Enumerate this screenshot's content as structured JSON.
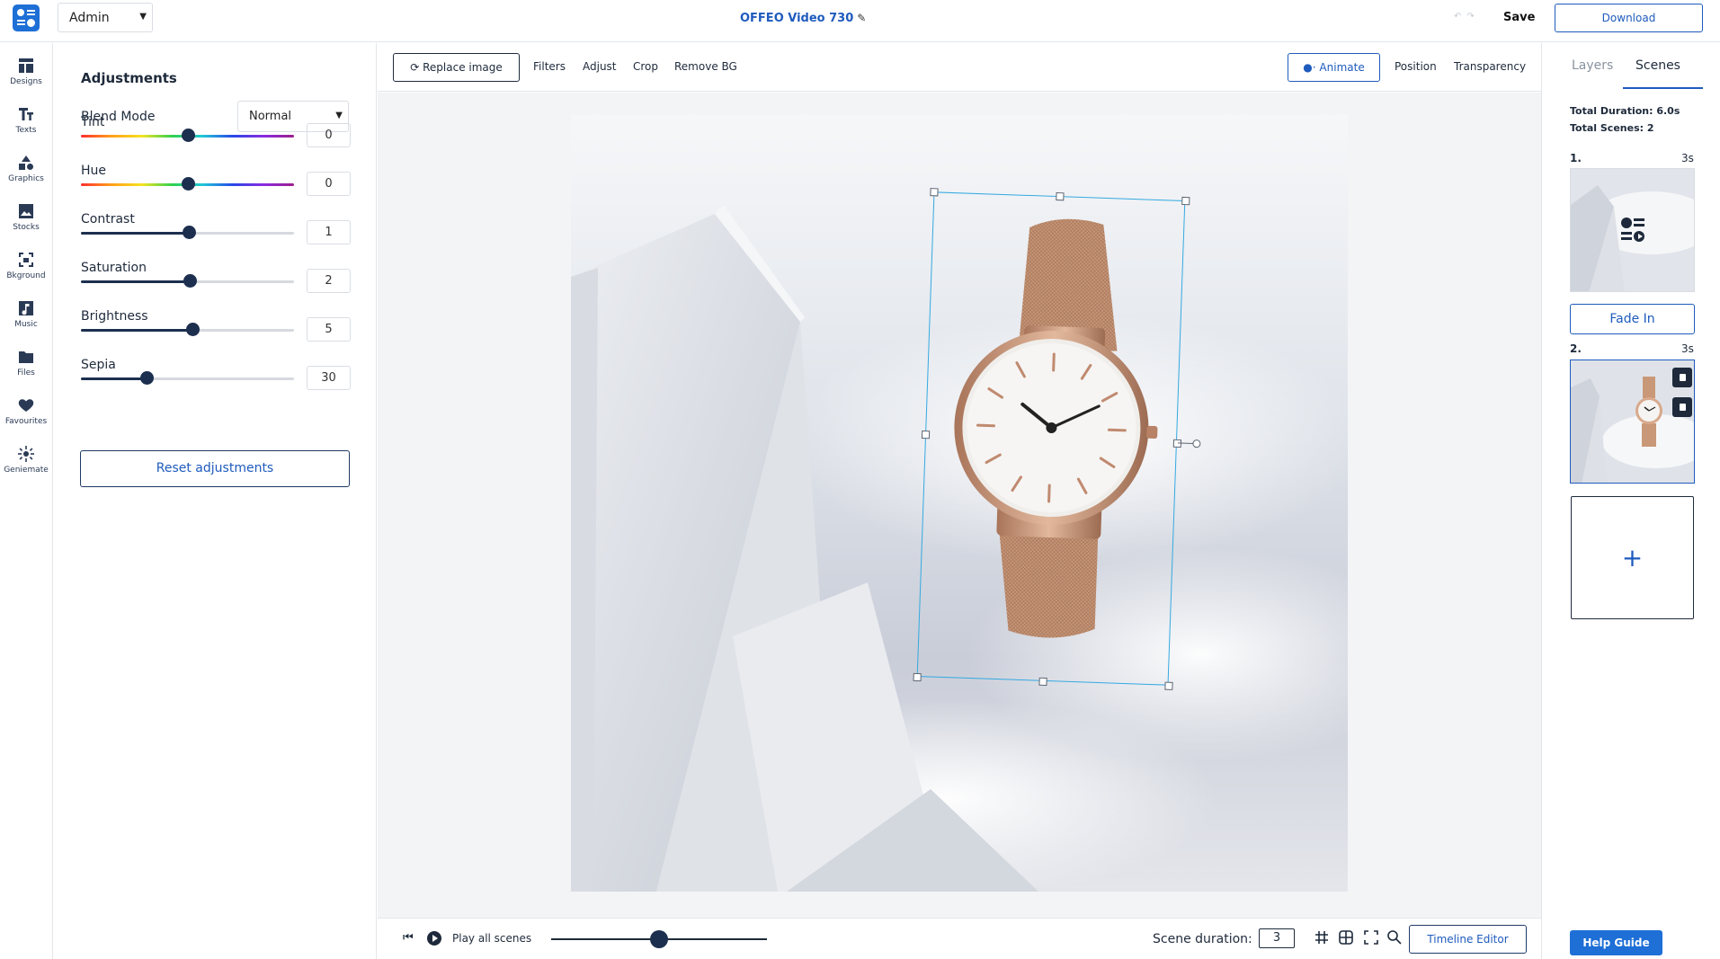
{
  "header": {
    "account": "Admin",
    "title": "OFFEO Video 730",
    "save_label": "Save",
    "download_label": "Download"
  },
  "rail": {
    "items": [
      {
        "label": "Designs",
        "icon": "designs-icon"
      },
      {
        "label": "Texts",
        "icon": "texts-icon"
      },
      {
        "label": "Graphics",
        "icon": "graphics-icon"
      },
      {
        "label": "Stocks",
        "icon": "stocks-icon"
      },
      {
        "label": "Bkground",
        "icon": "background-icon"
      },
      {
        "label": "Music",
        "icon": "music-icon"
      },
      {
        "label": "Files",
        "icon": "files-icon"
      },
      {
        "label": "Favourites",
        "icon": "heart-icon"
      },
      {
        "label": "Geniemate",
        "icon": "geniemate-icon"
      }
    ]
  },
  "adjustments": {
    "title": "Adjustments",
    "blend_mode_label": "Blend Mode",
    "blend_mode_value": "Normal",
    "sliders": [
      {
        "label": "Tint",
        "value": "0",
        "level": 0.5,
        "style": "rainbow"
      },
      {
        "label": "Hue",
        "value": "0",
        "level": 0.5,
        "style": "rainbow"
      },
      {
        "label": "Contrast",
        "value": "1",
        "level": 0.505,
        "style": "plain"
      },
      {
        "label": "Saturation",
        "value": "2",
        "level": 0.51,
        "style": "plain"
      },
      {
        "label": "Brightness",
        "value": "5",
        "level": 0.525,
        "style": "plain"
      },
      {
        "label": "Sepia",
        "value": "30",
        "level": 0.31,
        "style": "plain"
      }
    ],
    "reset_label": "Reset adjustments"
  },
  "toolbar": {
    "replace_label": "Replace image",
    "filters_label": "Filters",
    "adjust_label": "Adjust",
    "crop_label": "Crop",
    "remove_bg_label": "Remove BG",
    "animate_label": "Animate",
    "position_label": "Position",
    "transparency_label": "Transparency"
  },
  "bottom": {
    "play_all_label": "Play all scenes",
    "timeline_progress": 0.5,
    "scene_duration_label": "Scene duration:",
    "scene_duration_value": "3",
    "timeline_editor_label": "Timeline Editor"
  },
  "scenes_panel": {
    "tab_layers": "Layers",
    "tab_scenes": "Scenes",
    "total_duration": "Total Duration: 6.0s",
    "total_scenes": "Total Scenes: 2",
    "scenes": [
      {
        "number": "1.",
        "duration": "3s",
        "transition": "Fade In"
      },
      {
        "number": "2.",
        "duration": "3s"
      }
    ],
    "add_label": "+",
    "help_label": "Help Guide"
  },
  "colors": {
    "brand": "#1e6fd6",
    "accent": "#1e5bbd",
    "selection": "#35a9e1",
    "dark": "#1d2f4f"
  }
}
